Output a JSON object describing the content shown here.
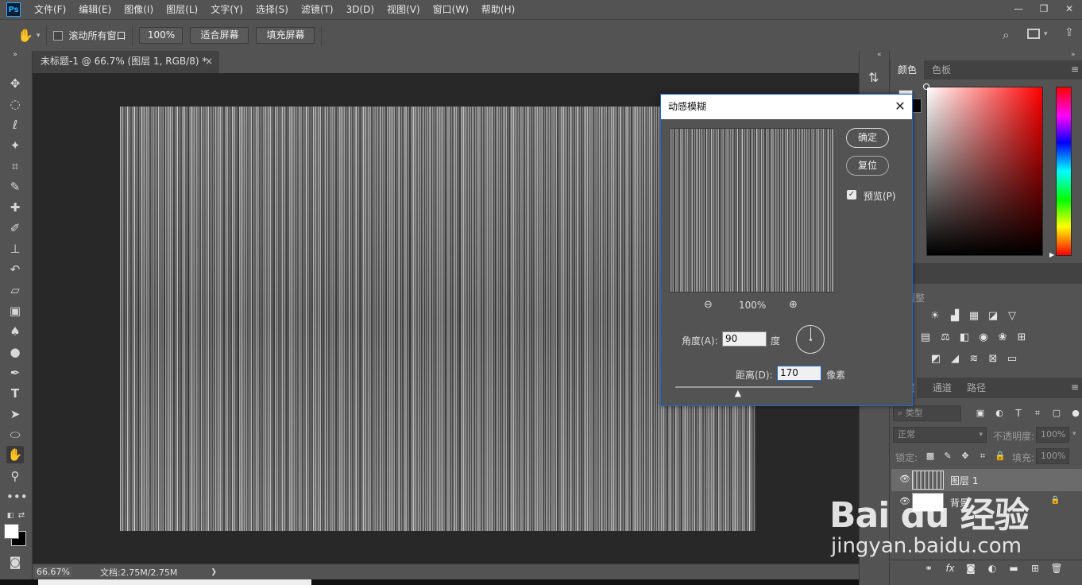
{
  "app": {
    "logo": "Ps"
  },
  "menubar": {
    "items": [
      "文件(F)",
      "编辑(E)",
      "图像(I)",
      "图层(L)",
      "文字(Y)",
      "选择(S)",
      "滤镜(T)",
      "3D(D)",
      "视图(V)",
      "窗口(W)",
      "帮助(H)"
    ]
  },
  "window_controls": {
    "minimize": "—",
    "restore": "❐",
    "close": "✕"
  },
  "options": {
    "scroll_all_label": "滚动所有窗口",
    "zoom_value": "100%",
    "fit_screen_label": "适合屏幕",
    "fill_screen_label": "填充屏幕"
  },
  "document": {
    "tab_title": "未标题-1 @ 66.7% (图层 1, RGB/8) *",
    "tab_close": "×"
  },
  "status": {
    "zoom": "66.67%",
    "doc_info": "文档:2.75M/2.75M",
    "arrow": "❯"
  },
  "panels": {
    "color_tab": "颜色",
    "swatches_tab": "色板",
    "adjust_label": "加调整",
    "layers_tab": "层",
    "channels_tab": "通道",
    "paths_tab": "路径",
    "filter_kind": "类型",
    "blend_mode": "正常",
    "opacity_label": "不透明度:",
    "opacity_value": "100%",
    "lock_label": "锁定:",
    "fill_label": "填充:",
    "fill_value": "100%",
    "layers": [
      {
        "name": "图层 1"
      },
      {
        "name": "背景"
      }
    ]
  },
  "dialog": {
    "title": "动感模糊",
    "ok_label": "确定",
    "reset_label": "复位",
    "preview_label": "预览(P)",
    "preview_checked": true,
    "zoom_value": "100%",
    "angle_label": "角度(A):",
    "angle_value": "90",
    "angle_unit": "度",
    "distance_label": "距离(D):",
    "distance_value": "170",
    "distance_unit": "像素",
    "distance_slider_fraction": 0.46
  },
  "watermark": {
    "text_main": "Bai du 经验",
    "text_url": "jingyan.baidu.com"
  },
  "colors": {
    "accent": "#1b6ad3",
    "panel_bg": "#535353",
    "workspace_bg": "#282828"
  }
}
